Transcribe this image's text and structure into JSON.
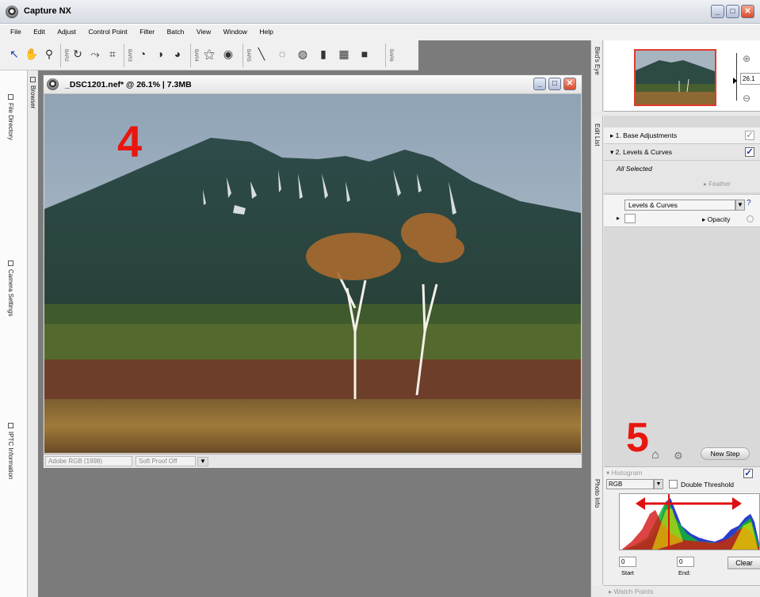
{
  "app": {
    "title": "Capture NX"
  },
  "menu": [
    "File",
    "Edit",
    "Adjust",
    "Control Point",
    "Filter",
    "Batch",
    "View",
    "Window",
    "Help"
  ],
  "toolbar": {
    "bar_labels": [
      "BAR2",
      "BAR3",
      "BAR4",
      "BAR5",
      "BAR6"
    ]
  },
  "image_window": {
    "title": "_DSC1201.nef* @ 26.1% | 7.3MB",
    "status_colorspace": "Adobe RGB (1998)",
    "status_softproof": "Soft Proof Off"
  },
  "left_dock": {
    "tabs": [
      "Browser",
      "File Directory",
      "Camera Settings",
      "IPTC Information"
    ]
  },
  "birds_eye": {
    "tab": "Bird's Eye",
    "zoom_value": "26.1",
    "zoom_unit": "%"
  },
  "edit_list": {
    "tab": "Edit List",
    "steps": [
      "1. Base Adjustments",
      "2. Levels & Curves"
    ],
    "all_selected": "All Selected",
    "feather": "Feather",
    "selected_tool": "Levels & Curves",
    "opacity": "Opacity",
    "new_step": "New Step"
  },
  "histogram": {
    "tab": "Photo Info",
    "title": "Histogram",
    "channel": "RGB",
    "double_threshold": "Double Threshold",
    "start_value": "0",
    "start_label": "Start",
    "end_value": "0",
    "end_label": "End:",
    "clear": "Clear"
  },
  "watch_points": "Watch Points",
  "annotations": {
    "number_4": "4",
    "number_5": "5"
  }
}
